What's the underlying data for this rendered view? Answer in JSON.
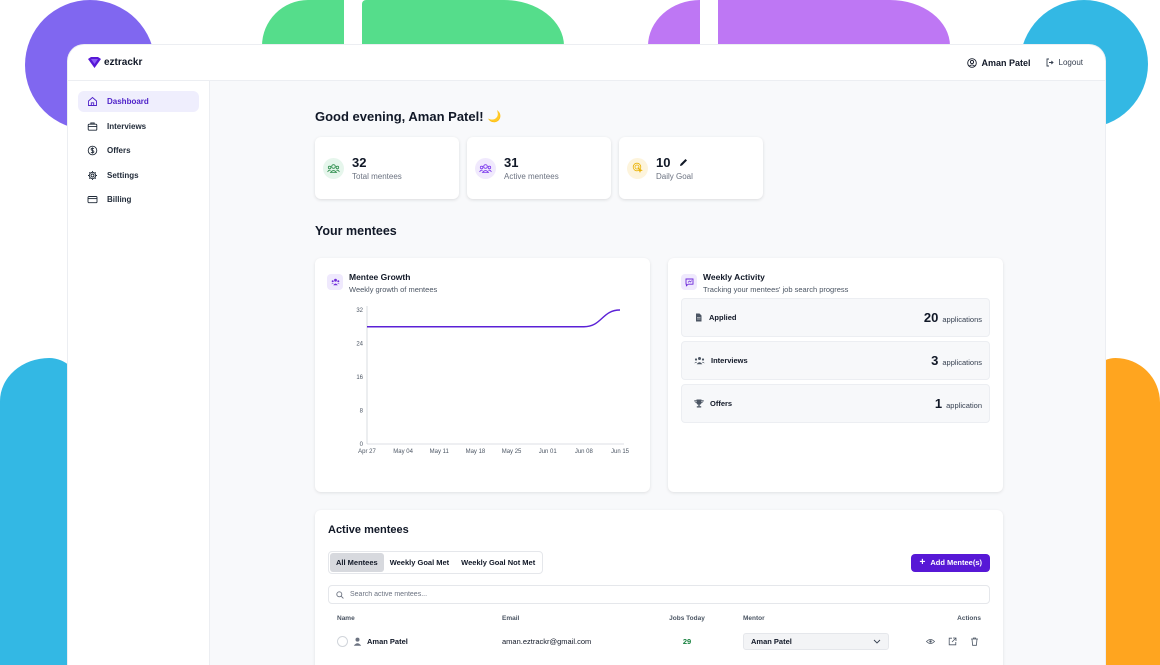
{
  "brand": {
    "name": "eztrackr",
    "color": "#5718d6"
  },
  "topbar": {
    "user_name": "Aman Patel",
    "logout_label": "Logout"
  },
  "sidebar": {
    "items": [
      {
        "label": "Dashboard",
        "icon": "home-icon",
        "active": true
      },
      {
        "label": "Interviews",
        "icon": "briefcase-icon",
        "active": false
      },
      {
        "label": "Offers",
        "icon": "dollar-icon",
        "active": false
      },
      {
        "label": "Settings",
        "icon": "gear-icon",
        "active": false
      },
      {
        "label": "Billing",
        "icon": "credit-card-icon",
        "active": false
      }
    ]
  },
  "greeting": {
    "text": "Good evening, Aman Patel!",
    "emoji": "🌙"
  },
  "stats": [
    {
      "value": "32",
      "label": "Total mentees",
      "icon": "users-icon"
    },
    {
      "value": "31",
      "label": "Active mentees",
      "icon": "users-icon"
    },
    {
      "value": "10",
      "label": "Daily Goal",
      "icon": "target-icon",
      "editable": true
    }
  ],
  "section_title": "Your mentees",
  "growth_panel": {
    "title": "Mentee Growth",
    "subtitle": "Weekly growth of mentees"
  },
  "chart_data": {
    "type": "line",
    "title": "Mentee Growth",
    "subtitle": "Weekly growth of mentees",
    "x": [
      "Apr 27",
      "May 04",
      "May 11",
      "May 18",
      "May 25",
      "Jun 01",
      "Jun 08",
      "Jun 15"
    ],
    "y_ticks": [
      0,
      8,
      16,
      24,
      32
    ],
    "ylim": [
      0,
      32
    ],
    "series": [
      {
        "values": [
          28,
          28,
          28,
          28,
          28,
          28,
          28,
          32
        ],
        "color": "#5b21d6"
      }
    ],
    "grid": false,
    "xlabel": "",
    "ylabel": ""
  },
  "activity_panel": {
    "title": "Weekly Activity",
    "subtitle": "Tracking your mentees' job search progress",
    "rows": [
      {
        "label": "Applied",
        "value": "20",
        "unit": "applications",
        "icon": "document-icon"
      },
      {
        "label": "Interviews",
        "value": "3",
        "unit": "applications",
        "icon": "users-icon"
      },
      {
        "label": "Offers",
        "value": "1",
        "unit": "application",
        "icon": "trophy-icon"
      }
    ]
  },
  "mentees_table": {
    "title": "Active mentees",
    "tabs": [
      "All Mentees",
      "Weekly Goal Met",
      "Weekly Goal Not Met"
    ],
    "active_tab": "All Mentees",
    "add_button": "Add Mentee(s)",
    "search_placeholder": "Search active mentees...",
    "columns": {
      "name": "Name",
      "email": "Email",
      "jobs": "Jobs Today",
      "mentor": "Mentor",
      "actions": "Actions"
    },
    "rows": [
      {
        "name": "Aman Patel",
        "email": "aman.eztrackr@gmail.com",
        "jobs_today": "29",
        "mentor": "Aman Patel"
      }
    ]
  }
}
